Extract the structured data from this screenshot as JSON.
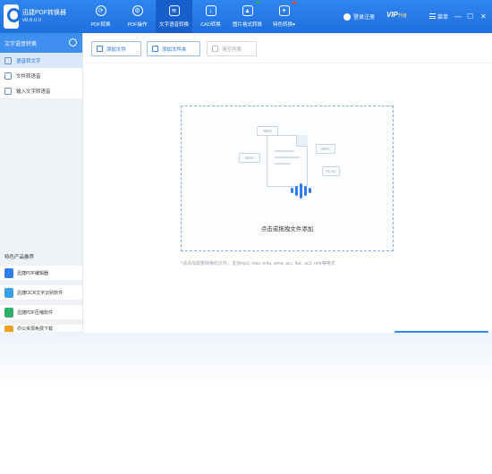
{
  "app": {
    "name": "迅捷PDF转换器",
    "version": "v8.6.0.0"
  },
  "nav": [
    {
      "label": "PDF转换",
      "icon": "pdf-convert-icon",
      "active": false
    },
    {
      "label": "PDF操作",
      "icon": "pdf-operate-icon",
      "active": false
    },
    {
      "label": "文字语音转换",
      "icon": "text-voice-icon",
      "active": true
    },
    {
      "label": "CAD转换",
      "icon": "cad-convert-icon",
      "active": false
    },
    {
      "label": "图片格式转换",
      "icon": "image-convert-icon",
      "active": false,
      "badge": ""
    },
    {
      "label": "特色转换▾",
      "icon": "special-convert-icon",
      "active": false,
      "badge": ""
    }
  ],
  "header": {
    "user_label": "登录注册",
    "vip_label": "VIP",
    "vip_sub": "升级",
    "menu_label": "菜单",
    "minimize": "—",
    "maximize": "☐",
    "close": "✕"
  },
  "sidebar": {
    "title": "文字语音转换",
    "items": [
      {
        "label": "语音转文字",
        "active": true
      },
      {
        "label": "文件转语音",
        "active": false
      },
      {
        "label": "输入文字转语音",
        "active": false
      }
    ],
    "promo_title": "特色产品推荐",
    "promos": [
      {
        "label": "迅捷PDF编辑器",
        "color": "#2f7cf0"
      },
      {
        "label": "迅捷OCR文字识别软件",
        "color": "#3aa0e8"
      },
      {
        "label": "迅捷PDF压缩软件",
        "color": "#2fb06a"
      },
      {
        "label": "办公资源免费下载",
        "color": "#f0a020"
      }
    ]
  },
  "toolbar": {
    "add_file": "添加文件",
    "add_folder": "添加文件夹",
    "clear_list": "清空列表"
  },
  "dropzone": {
    "label": "点击或拖拽文件添加",
    "tags": [
      "MP3",
      "WAV",
      "M4A",
      "FLAC"
    ]
  },
  "hint": "*请添加需要转换的文件，支持mp3, mav, m4a, wma, acc, flac, ac3, m4r等格式",
  "colors": {
    "brand": "#1f6fe0",
    "accent": "#2f86f0",
    "dropzone_border": "#7fb0ee"
  }
}
